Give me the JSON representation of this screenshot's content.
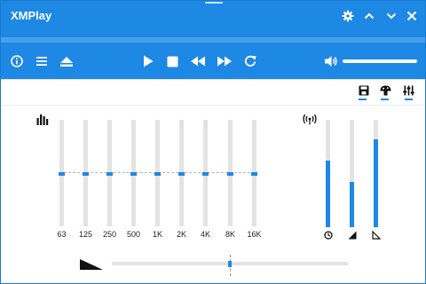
{
  "window": {
    "title": "XMPlay",
    "controls": {
      "settings_icon": "gear-icon",
      "minimize_icon": "chevron-up-icon",
      "close_icon": "close-icon"
    }
  },
  "player": {
    "buttons": [
      "info-icon",
      "menu-icon",
      "eject-icon",
      "play-icon",
      "stop-icon",
      "rewind-icon",
      "fast-forward-icon",
      "repeat-icon",
      "volume-icon"
    ],
    "volume_level": 1.0
  },
  "modes": {
    "items": [
      {
        "icon": "save-icon",
        "active": true
      },
      {
        "icon": "mushroom-icon",
        "active": true
      },
      {
        "icon": "sliders-icon",
        "active": true
      }
    ]
  },
  "equalizer": {
    "icon": "equalizer-bars-icon",
    "bands": [
      {
        "label": "63",
        "gain": 0
      },
      {
        "label": "125",
        "gain": 0
      },
      {
        "label": "250",
        "gain": 0
      },
      {
        "label": "500",
        "gain": 0
      },
      {
        "label": "1K",
        "gain": 0
      },
      {
        "label": "2K",
        "gain": 0
      },
      {
        "label": "4K",
        "gain": 0
      },
      {
        "label": "8K",
        "gain": 0
      },
      {
        "label": "16K",
        "gain": 0
      }
    ]
  },
  "effects": {
    "icon": "antenna-signal-icon",
    "meters": [
      {
        "icon": "clock-icon",
        "level": 0.62
      },
      {
        "icon": "filled-triangle-icon",
        "level": 0.42
      },
      {
        "icon": "outline-triangle-icon",
        "level": 0.82
      }
    ]
  },
  "balance": {
    "icon": "wedge-icon",
    "value": 0
  },
  "colors": {
    "accent": "#1e88e5",
    "stripe": "#4aa0ec",
    "track": "#e3e3e3"
  }
}
